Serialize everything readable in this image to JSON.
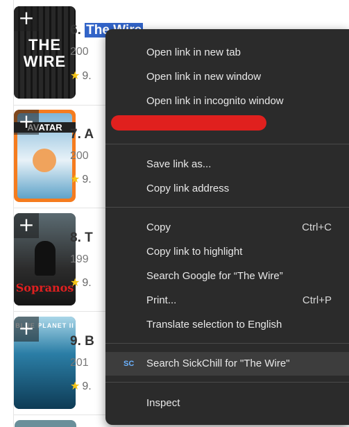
{
  "list": {
    "items": [
      {
        "rank_title_prefix": "6. ",
        "title_highlight": "The Wire",
        "year": "200",
        "rating": "9.",
        "poster_text": "THE WIRE",
        "poster_bg": "#1e1e1e"
      },
      {
        "rank_title_prefix": "7. A",
        "year": "200",
        "rating": "9.",
        "poster_text": "AVATAR",
        "poster_bg": "#f57c1f"
      },
      {
        "rank_title_prefix": "8. T",
        "year": "199",
        "rating": "9.",
        "poster_text": "Sopranos",
        "poster_bg": "#3a3a3a"
      },
      {
        "rank_title_prefix": "9. B",
        "year": "201",
        "rating": "9.",
        "poster_text": "BLUE PLANET II",
        "poster_bg": "#1a4f6e"
      }
    ],
    "plus_symbol": "+",
    "star_symbol": "★"
  },
  "menu": {
    "items": {
      "open_new_tab": "Open link in new tab",
      "open_new_window": "Open link in new window",
      "open_incognito": "Open link in incognito window",
      "save_link": "Save link as...",
      "copy_link_address": "Copy link address",
      "copy": "Copy",
      "copy_shortcut": "Ctrl+C",
      "copy_link_highlight": "Copy link to highlight",
      "search_google": "Search Google for “The Wire”",
      "print": "Print...",
      "print_shortcut": "Ctrl+P",
      "translate": "Translate selection to English",
      "search_sickchill": "Search SickChill for \"The Wire\"",
      "sickchill_icon_text": "SC",
      "inspect": "Inspect"
    }
  },
  "colors": {
    "menu_bg": "#2b2b2b",
    "highlight": "#3264c8",
    "redaction": "#e0201e",
    "star": "#f5c518"
  }
}
